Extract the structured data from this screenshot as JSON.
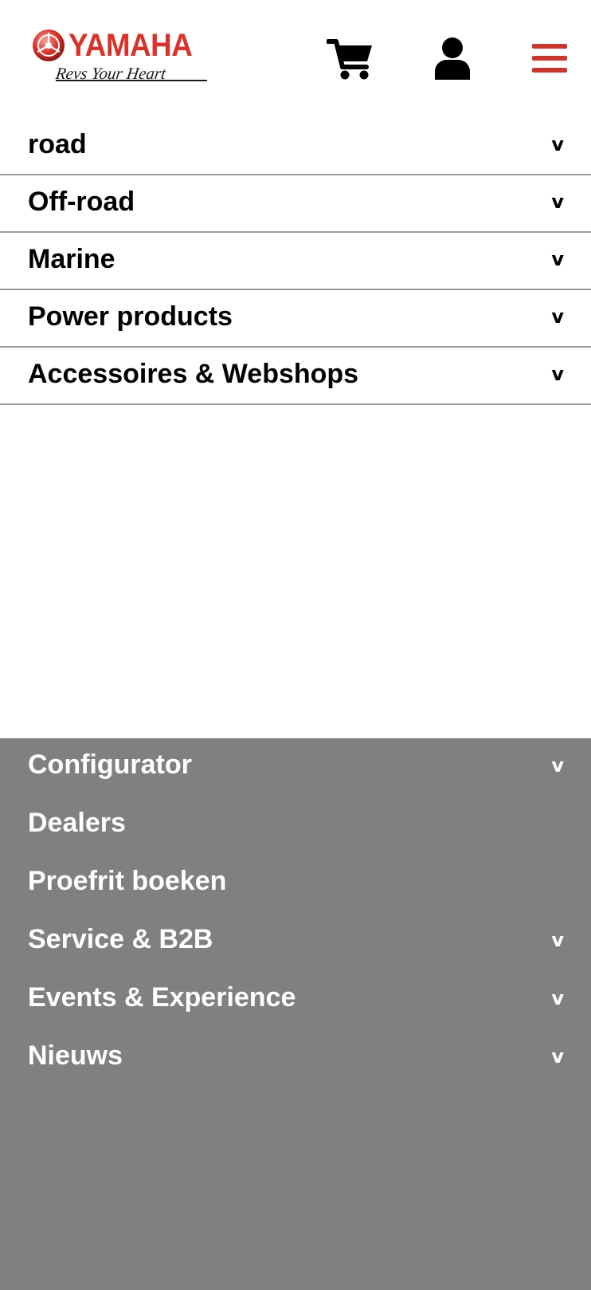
{
  "brand": {
    "name": "YAMAHA",
    "tagline": "Revs Your Heart",
    "color": "#d8322a"
  },
  "header": {
    "icons": {
      "cart": "shopping-cart-icon",
      "account": "user-icon",
      "menu": "hamburger-menu-icon"
    },
    "menu_color": "#c8372d"
  },
  "primary_nav": {
    "chevron": "v",
    "items": [
      {
        "label": "road",
        "expandable": true
      },
      {
        "label": "Off-road",
        "expandable": true
      },
      {
        "label": "Marine",
        "expandable": true
      },
      {
        "label": "Power products",
        "expandable": true
      },
      {
        "label": "Accessoires & Webshops",
        "expandable": true
      }
    ]
  },
  "secondary_nav": {
    "background": "#808080",
    "items": [
      {
        "label": "Configurator",
        "chevron": "v"
      },
      {
        "label": "Dealers",
        "chevron": ""
      },
      {
        "label": "Proefrit boeken",
        "chevron": ""
      },
      {
        "label": "Service & B2B",
        "chevron": "v"
      },
      {
        "label": "Events & Experience",
        "chevron": "v"
      },
      {
        "label": "Nieuws",
        "chevron": "v"
      }
    ]
  }
}
